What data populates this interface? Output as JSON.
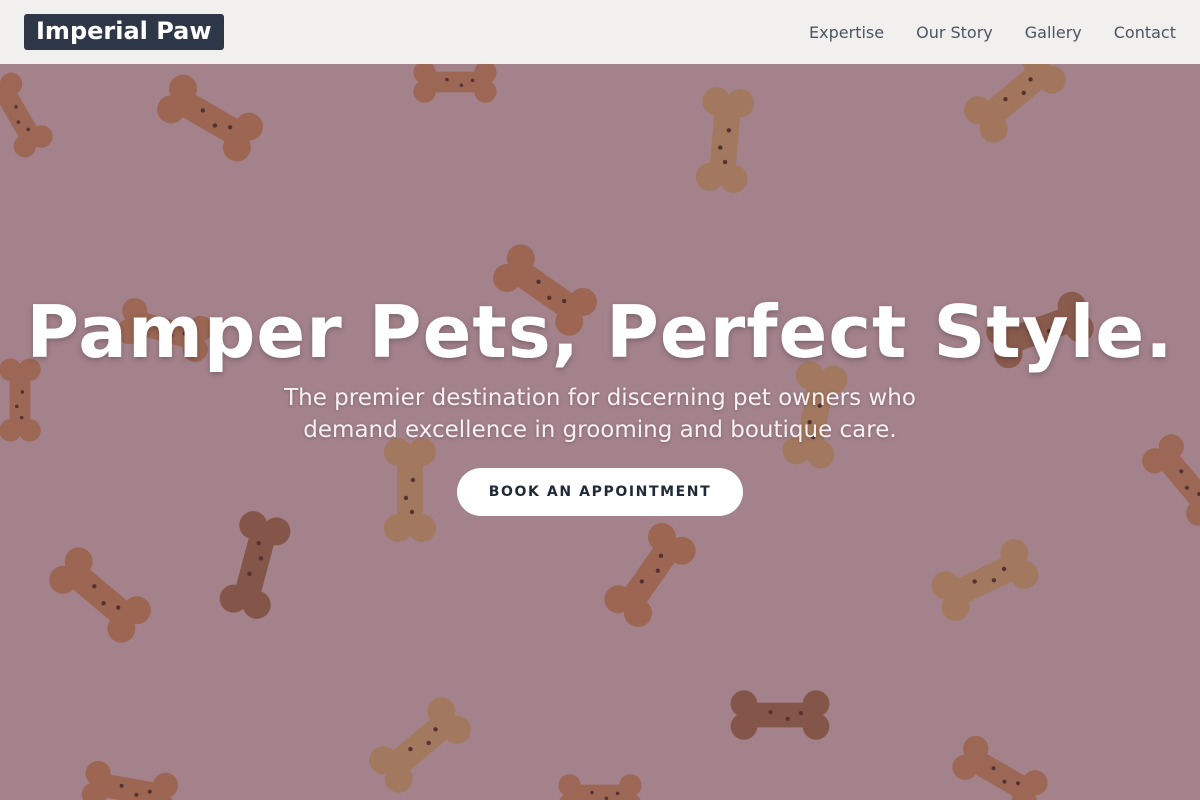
{
  "brand": {
    "name": "Imperial Paw"
  },
  "nav": {
    "items": [
      {
        "label": "Expertise"
      },
      {
        "label": "Our Story"
      },
      {
        "label": "Gallery"
      },
      {
        "label": "Contact"
      }
    ]
  },
  "hero": {
    "title": "Pamper Pets, Perfect Style.",
    "subtitle": "The premier destination for discerning pet owners who demand excellence in grooming and boutique care.",
    "cta_label": "BOOK AN APPOINTMENT",
    "background": "dog-bone-biscuits-on-pink"
  },
  "colors": {
    "logo_bg": "#2e3748",
    "header_bg": "#f5f3f3",
    "nav_text": "#4b5563",
    "overlay": "#5f3746",
    "cta_bg": "#ffffff",
    "cta_text": "#1f2937"
  }
}
